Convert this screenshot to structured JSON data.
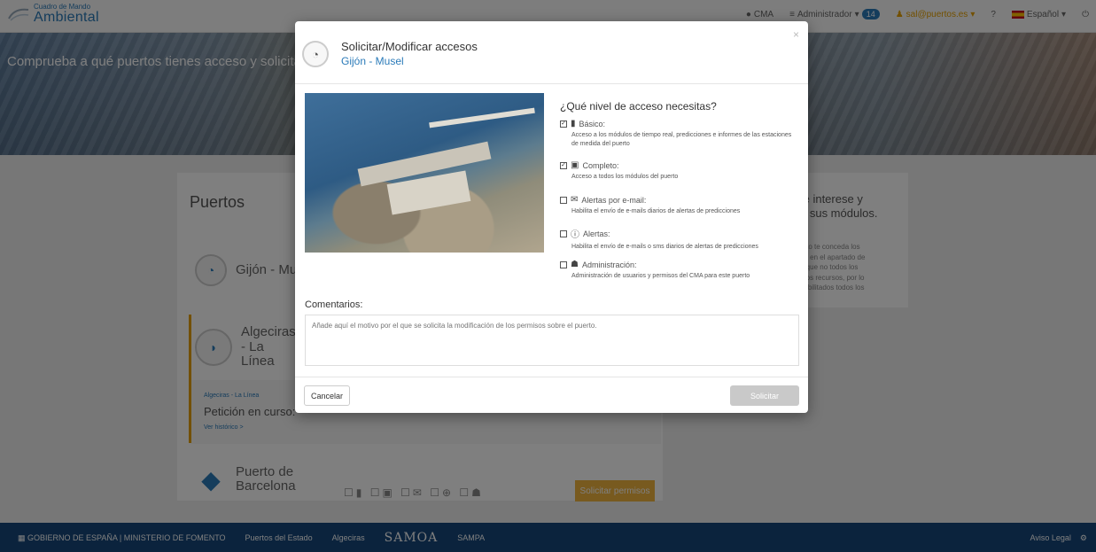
{
  "app": {
    "logo_small": "Cuadro de Mando",
    "logo_big": "Ambiental"
  },
  "topnav": {
    "cma": "CMA",
    "admin": "Administrador",
    "admin_badge": "14",
    "user": "sal@puertos.es",
    "help": "?",
    "language": "Español"
  },
  "hero": {
    "text": "Comprueba a qué puertos tienes acceso y solicita"
  },
  "panel": {
    "title": "Puertos",
    "ports": [
      {
        "name": "Gijón - Musel"
      },
      {
        "name": "Algeciras - La Línea"
      },
      {
        "name": "Puerto de Barcelona"
      }
    ],
    "request": {
      "small": "Algeciras - La Línea",
      "title": "Petición en curso:",
      "link": "Ver histórico >"
    },
    "request_button": "Solicitar permisos"
  },
  "sidebox": {
    "title_1": "te interese y",
    "title_2": "e sus módulos.",
    "lines": [
      "erto te conceda los",
      "ón en el apartado de",
      "a que no todos los",
      "mos recursos, por lo",
      "habilitados todos los"
    ]
  },
  "footer": {
    "brand_1": "Puertos del Estado",
    "brand_2": "Algeciras",
    "brand_3": "SAMOA",
    "brand_4": "SAMPA",
    "legal": "Aviso Legal"
  },
  "modal": {
    "title": "Solicitar/Modificar accesos",
    "subtitle": "Gijón - Musel",
    "question": "¿Qué nivel de acceso necesitas?",
    "options": [
      {
        "label": "Básico:",
        "desc": "Acceso a los módulos de tiempo real, predicciones e informes de las estaciones de medida del puerto",
        "checked": true,
        "icon": "building-icon"
      },
      {
        "label": "Completo:",
        "desc": "Acceso a todos los módulos del puerto",
        "checked": true,
        "icon": "document-icon"
      },
      {
        "label": "Alertas por e-mail:",
        "desc": "Habilita el envío de e-mails diarios de alertas de predicciones",
        "checked": false,
        "icon": "mail-icon"
      },
      {
        "label": "Alertas:",
        "desc": "Habilita el envío de e-mails o sms diarios de alertas de predicciones",
        "checked": false,
        "icon": "alert-icon"
      },
      {
        "label": "Administración:",
        "desc": "Administración de usuarios y permisos del CMA para este puerto",
        "checked": false,
        "icon": "admin-icon"
      }
    ],
    "comments_label": "Comentarios:",
    "comments_placeholder": "Añade aquí el motivo por el que se solicita la modificación de los permisos sobre el puerto.",
    "cancel": "Cancelar",
    "submit": "Solicitar"
  }
}
